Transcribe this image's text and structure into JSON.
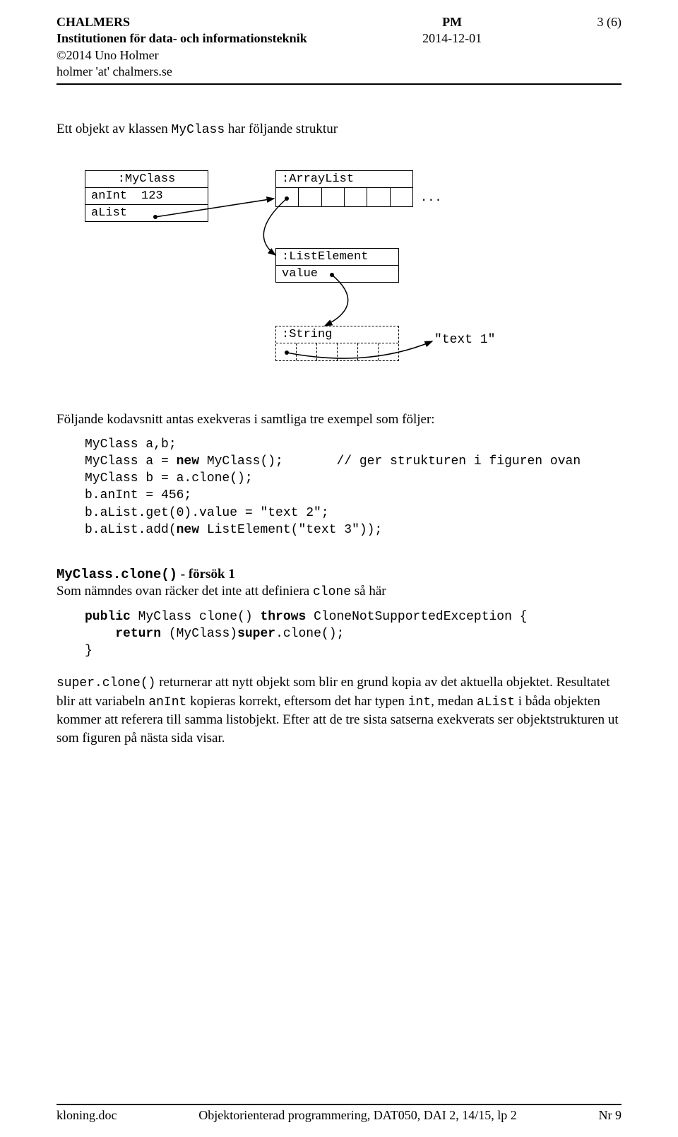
{
  "header": {
    "org": "CHALMERS",
    "dept": "Institutionen för data- och informationsteknik",
    "copyright": "©2014 Uno Holmer",
    "email": "holmer 'at' chalmers.se",
    "doctype": "PM",
    "date": "2014-12-01",
    "page": "3 (6)"
  },
  "intro": {
    "prefix": "Ett objekt av klassen ",
    "classname": "MyClass",
    "suffix": "  har följande struktur"
  },
  "diagram": {
    "myclass": ":MyClass",
    "anint_label": "anInt",
    "anint_value": "123",
    "alist_label": "aList",
    "arraylist": ":ArrayList",
    "ellipsis": "...",
    "listelement": ":ListElement",
    "value_label": "value",
    "string": ":String",
    "text1": "\"text 1\""
  },
  "codeintro": "Följande kodavsnitt antas exekveras i samtliga tre exempel som följer:",
  "code1": {
    "l1": "MyClass a,b;",
    "l2a": "MyClass a = ",
    "l2b": "new",
    "l2c": " MyClass();       // ger strukturen i figuren ovan",
    "l3": "MyClass b = a.clone();",
    "l4": "b.anInt = 456;",
    "l5": "b.aList.get(0).value = \"text 2\";",
    "l6a": "b.aList.add(",
    "l6b": "new",
    "l6c": " ListElement(\"text 3\"));"
  },
  "sec1": {
    "title_code": "MyClass.clone()",
    "title_rest": " - försök 1",
    "p1a": "Som nämndes ovan räcker det inte att definiera ",
    "p1b": "clone",
    "p1c": " så här"
  },
  "code2": {
    "l1a": "public",
    "l1b": " MyClass clone() ",
    "l1c": "throws",
    "l1d": " CloneNotSupportedException {",
    "l2a": "    ",
    "l2b": "return",
    "l2c": " (MyClass)",
    "l2d": "super",
    "l2e": ".clone();",
    "l3": "}"
  },
  "para2": {
    "a": "super.clone()",
    "b": " returnerar att nytt objekt som blir en grund kopia av det aktuella objektet. Resultatet blir att variabeln ",
    "c": "anInt",
    "d": " kopieras korrekt, eftersom det har typen ",
    "e": "int",
    "f": ", medan ",
    "g": "aList",
    "h": " i båda objekten kommer att referera till samma listobjekt. Efter att de tre sista satserna exekverats ser objektstrukturen ut som figuren på nästa sida visar."
  },
  "footer": {
    "left": "kloning.doc",
    "center": "Objektorienterad programmering, DAT050, DAI 2, 14/15, lp 2",
    "right": "Nr  9"
  }
}
